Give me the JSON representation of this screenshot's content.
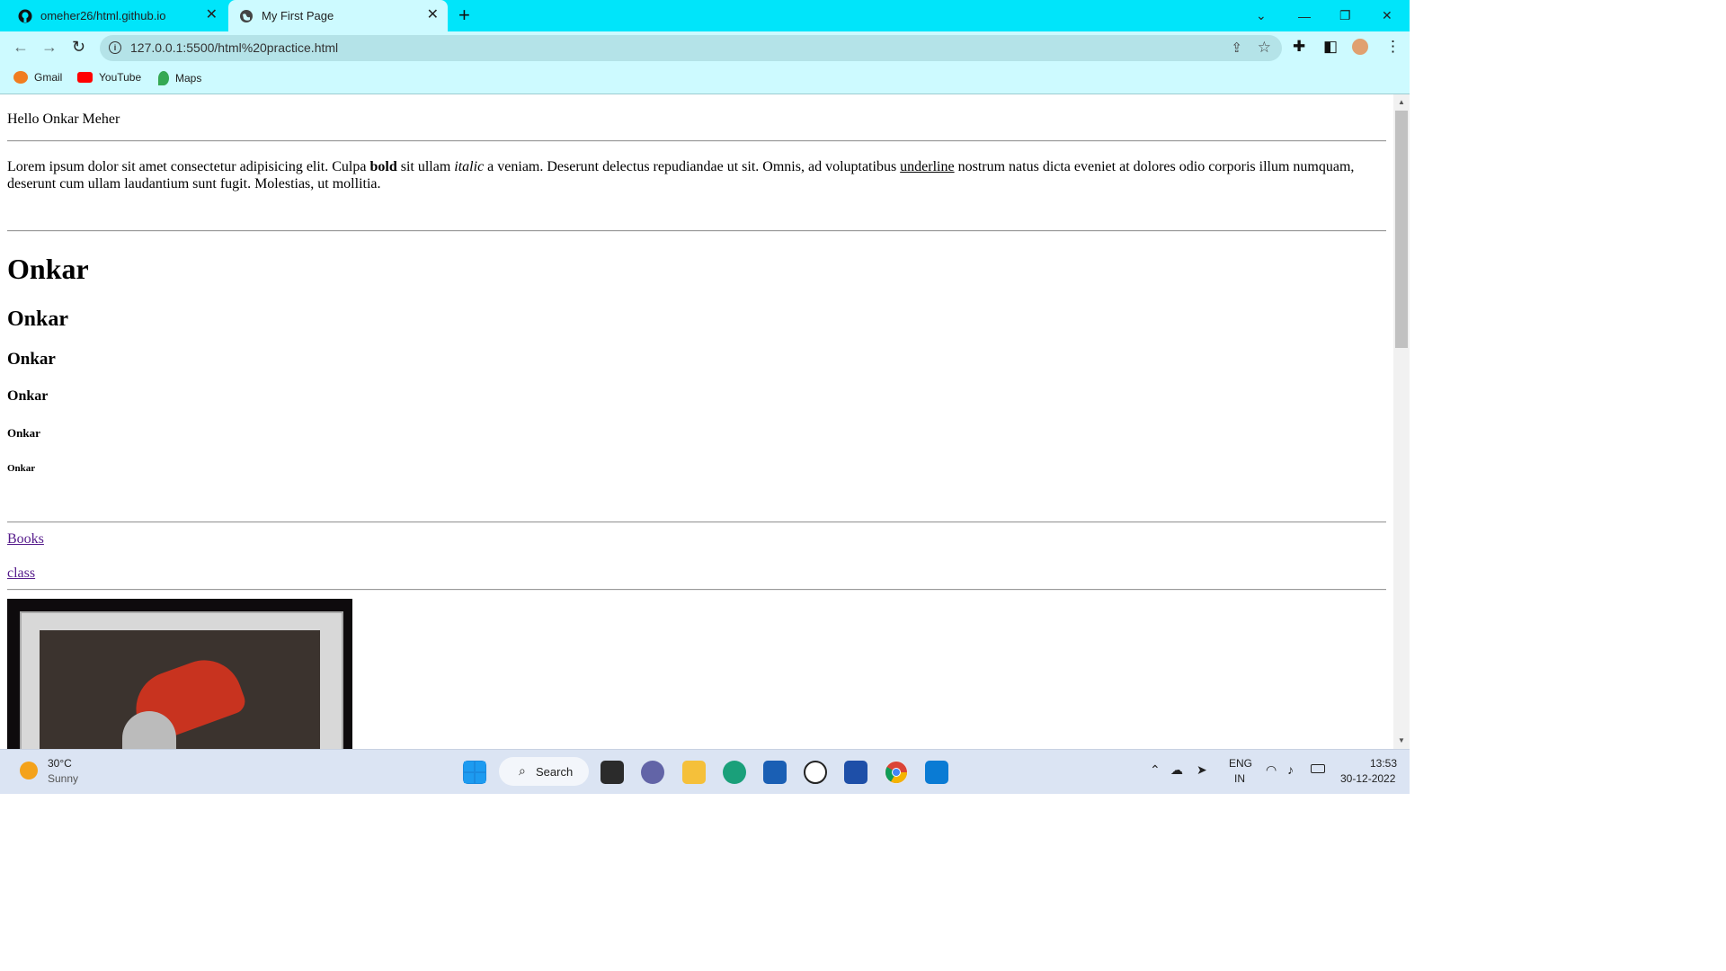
{
  "browser": {
    "tabs": [
      {
        "title": "omeher26/html.github.io",
        "icon": "github-icon",
        "active": false
      },
      {
        "title": "My First Page",
        "icon": "globe-icon",
        "active": true
      }
    ],
    "url": "127.0.0.1:5500/html%20practice.html",
    "bookmarks": [
      {
        "label": "Gmail",
        "icon": "gmail-icon"
      },
      {
        "label": "YouTube",
        "icon": "youtube-icon"
      },
      {
        "label": "Maps",
        "icon": "maps-icon"
      }
    ]
  },
  "page": {
    "greeting": "Hello Onkar Meher",
    "lorem": {
      "part1": "Lorem ipsum dolor sit amet consectetur adipisicing elit. Culpa ",
      "bold": "bold",
      "part2": " sit ullam ",
      "italic": "italic",
      "part3": " a veniam. Deserunt delectus repudiandae ut sit. Omnis, ad voluptatibus ",
      "underline": "underline",
      "part4": " nostrum natus dicta eveniet at dolores odio corporis illum numquam, deserunt cum ullam laudantium sunt fugit. Molestias, ut mollitia."
    },
    "headings": [
      "Onkar",
      "Onkar",
      "Onkar",
      "Onkar",
      "Onkar",
      "Onkar"
    ],
    "links": [
      "Books",
      "class"
    ],
    "image_alt": "Framed portrait artwork"
  },
  "taskbar": {
    "weather_temp": "30°C",
    "weather_desc": "Sunny",
    "search_label": "Search",
    "lang_line1": "ENG",
    "lang_line2": "IN",
    "time": "13:53",
    "date": "30-12-2022"
  }
}
